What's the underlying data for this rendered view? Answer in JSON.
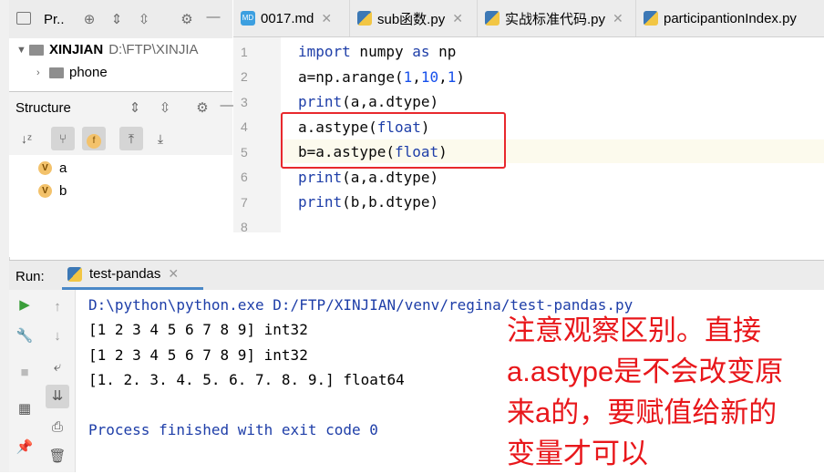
{
  "colors": {
    "annotation": "#e8171b",
    "keyword": "#1e3ea8",
    "number": "#1750eb",
    "highlight_box": "#e8282d"
  },
  "project": {
    "title": "Pr..",
    "root_name": "XINJIAN",
    "root_path": "D:\\FTP\\XINJIA",
    "child": "phone"
  },
  "structure": {
    "title": "Structure",
    "items": [
      {
        "name": "a"
      },
      {
        "name": "b"
      }
    ],
    "badge": "V"
  },
  "tabs": [
    {
      "label": "0017.md",
      "icon": "markdown-file-icon"
    },
    {
      "label": "sub函数.py",
      "icon": "python-file-icon"
    },
    {
      "label": "实战标准代码.py",
      "icon": "python-file-icon"
    },
    {
      "label": "participantionIndex.py",
      "icon": "python-file-icon"
    }
  ],
  "editor": {
    "line_numbers": [
      "1",
      "2",
      "3",
      "4",
      "5",
      "6",
      "7",
      "8"
    ],
    "lines": [
      [
        {
          "t": "import",
          "c": "kw"
        },
        {
          "t": " numpy ",
          "c": "plain"
        },
        {
          "t": "as",
          "c": "kw"
        },
        {
          "t": " np",
          "c": "plain"
        }
      ],
      [
        {
          "t": "a=np.arange(",
          "c": "plain"
        },
        {
          "t": "1",
          "c": "num"
        },
        {
          "t": ",",
          "c": "plain"
        },
        {
          "t": "10",
          "c": "num"
        },
        {
          "t": ",",
          "c": "plain"
        },
        {
          "t": "1",
          "c": "num"
        },
        {
          "t": ")",
          "c": "plain"
        }
      ],
      [
        {
          "t": "print",
          "c": "kw"
        },
        {
          "t": "(a,a.dtype)",
          "c": "plain"
        }
      ],
      [
        {
          "t": "a.astype(",
          "c": "plain"
        },
        {
          "t": "float",
          "c": "kw"
        },
        {
          "t": ")",
          "c": "plain"
        }
      ],
      [
        {
          "t": "b=a.astype(",
          "c": "plain"
        },
        {
          "t": "float",
          "c": "kw"
        },
        {
          "t": ")",
          "c": "plain"
        }
      ],
      [
        {
          "t": "print",
          "c": "kw"
        },
        {
          "t": "(a,a.dtype)",
          "c": "plain"
        }
      ],
      [
        {
          "t": "print",
          "c": "kw"
        },
        {
          "t": "(b,b.dtype)",
          "c": "plain"
        }
      ],
      []
    ]
  },
  "run": {
    "label": "Run:",
    "tab": "test-pandas",
    "output": [
      "D:\\python\\python.exe D:/FTP/XINJIAN/venv/regina/test-pandas.py",
      "[1 2 3 4 5 6 7 8 9] int32",
      "[1 2 3 4 5 6 7 8 9] int32",
      "[1. 2. 3. 4. 5. 6. 7. 8. 9.] float64",
      "",
      "Process finished with exit code 0"
    ]
  },
  "annotation": {
    "lines": [
      "注意观察区别。直接",
      "a.astype是不会改变原",
      "来a的，要赋值给新的",
      "变量才可以"
    ]
  }
}
